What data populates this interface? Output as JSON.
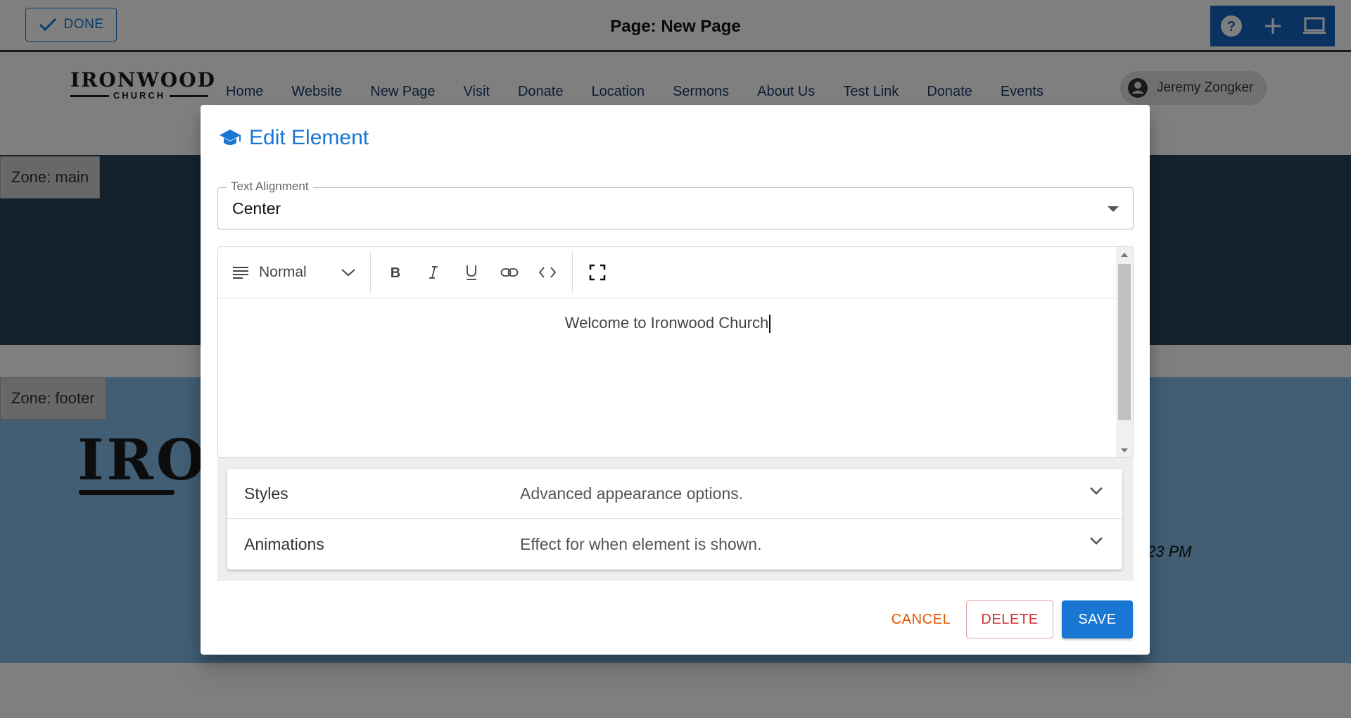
{
  "topbar": {
    "done_label": "DONE",
    "page_title": "Page: New Page",
    "tools": [
      "help-icon",
      "add-icon",
      "desktop-icon"
    ]
  },
  "site": {
    "logo_line1": "IRONWOOD",
    "logo_line2": "CHURCH",
    "nav": [
      "Home",
      "Website",
      "New Page",
      "Visit",
      "Donate",
      "Location",
      "Sermons",
      "About Us",
      "Test Link",
      "Donate",
      "Events"
    ],
    "user_name": "Jeremy Zongker",
    "zone_main_label": "Zone: main",
    "zone_footer_label": "Zone: footer",
    "footer_logo_text": "IRO",
    "footer_time": "23 PM"
  },
  "dialog": {
    "title": "Edit Element",
    "title_icon": "school-icon",
    "text_alignment": {
      "label": "Text Alignment",
      "value": "Center"
    },
    "editor": {
      "block_type": "Normal",
      "toolbar_buttons": [
        "bold-icon",
        "italic-icon",
        "underline-icon",
        "link-icon",
        "code-icon",
        "fullscreen-icon"
      ],
      "content": "Welcome to Ironwood Church"
    },
    "accordion": [
      {
        "title": "Styles",
        "description": "Advanced appearance options."
      },
      {
        "title": "Animations",
        "description": "Effect for when element is shown."
      }
    ],
    "buttons": {
      "cancel": "CANCEL",
      "delete": "DELETE",
      "save": "SAVE"
    }
  },
  "colors": {
    "primary": "#1976d2",
    "cancel": "#e65100",
    "delete": "#d32f2f",
    "zone_main": "#264459",
    "zone_footer": "#82bde8"
  }
}
